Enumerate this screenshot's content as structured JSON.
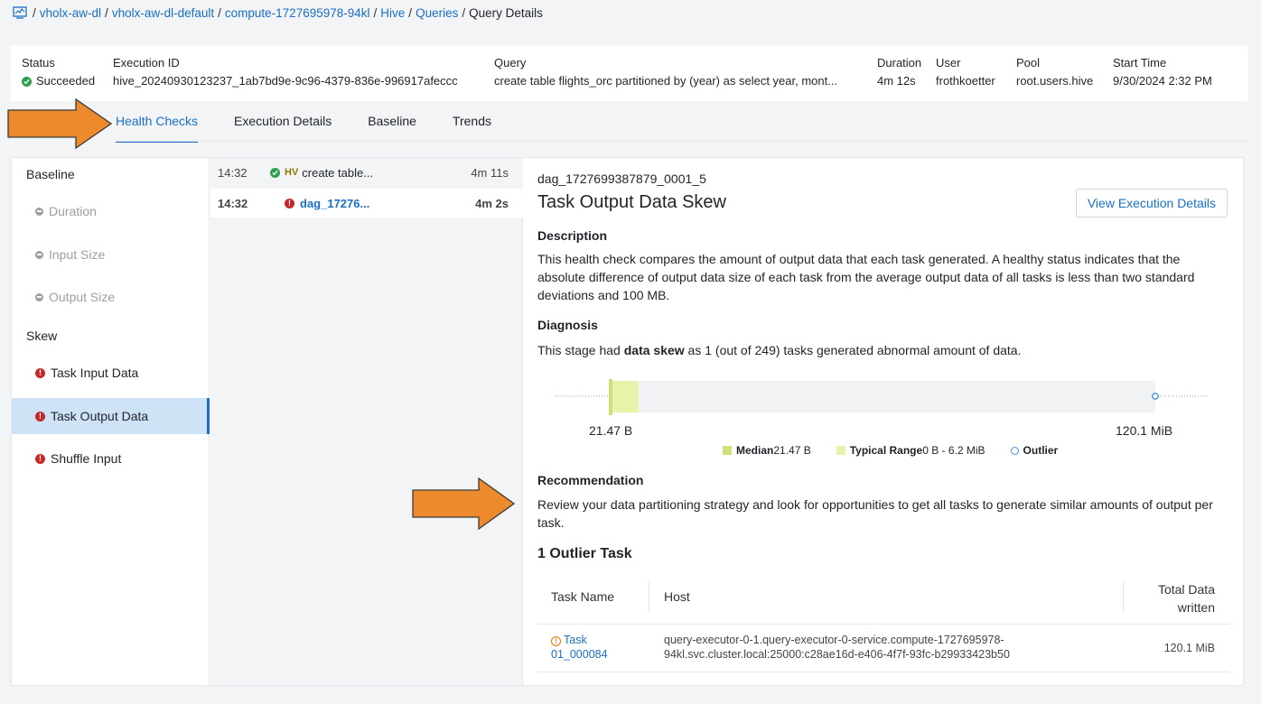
{
  "breadcrumb": {
    "icon": "chart-monitor-icon",
    "items": [
      "vholx-aw-dl",
      "vholx-aw-dl-default",
      "compute-1727695978-94kl",
      "Hive",
      "Queries"
    ],
    "current": "Query Details"
  },
  "summary": {
    "status": {
      "label": "Status",
      "value": "Succeeded"
    },
    "execution_id": {
      "label": "Execution ID",
      "value": "hive_20240930123237_1ab7bd9e-9c96-4379-836e-996917afeccc"
    },
    "query": {
      "label": "Query",
      "value": "create table flights_orc partitioned by (year) as select year, mont..."
    },
    "duration": {
      "label": "Duration",
      "value": "4m 12s"
    },
    "user": {
      "label": "User",
      "value": "frothkoetter"
    },
    "pool": {
      "label": "Pool",
      "value": "root.users.hive"
    },
    "start_time": {
      "label": "Start Time",
      "value": "9/30/2024 2:32 PM"
    }
  },
  "tabs": [
    "Health Checks",
    "Execution Details",
    "Baseline",
    "Trends"
  ],
  "left_nav": {
    "baseline_header": "Baseline",
    "baseline_items": [
      "Duration",
      "Input Size",
      "Output Size"
    ],
    "skew_header": "Skew",
    "skew_items": [
      "Task Input Data",
      "Task Output Data",
      "Shuffle Input"
    ]
  },
  "middle_list": [
    {
      "time": "14:32",
      "badge": "HV",
      "label": "create table...",
      "duration": "4m 11s"
    },
    {
      "time": "14:32",
      "label": "dag_17276...",
      "duration": "4m 2s"
    }
  ],
  "detail": {
    "dag_id": "dag_1727699387879_0001_5",
    "title": "Task Output Data Skew",
    "view_button": "View Execution Details",
    "description_heading": "Description",
    "description": "This health check compares the amount of output data that each task generated. A healthy status indicates that the absolute difference of output data size of each task from the average output data of all tasks is less than two standard deviations and 100 MB.",
    "diagnosis_heading": "Diagnosis",
    "diagnosis_pre": "This stage had ",
    "diagnosis_bold": "data skew",
    "diagnosis_post": " as 1 (out of 249) tasks generated abnormal amount of data.",
    "recommendation_heading": "Recommendation",
    "recommendation": "Review your data partitioning strategy and look for opportunities to get all tasks to generate similar amounts of output per task.",
    "outlier_heading": "1 Outlier Task",
    "table": {
      "headers": [
        "Task Name",
        "Host",
        "Total Data written"
      ],
      "rows": [
        {
          "task_name": "Task 01_000084",
          "host": "query-executor-0-1.query-executor-0-service.compute-1727695978-94kl.svc.cluster.local:25000:c28ae16d-e406-4f7f-93fc-b29933423b50",
          "total": "120.1 MiB"
        }
      ]
    }
  },
  "chart_data": {
    "type": "box",
    "min_label": "21.47 B",
    "max_label": "120.1 MiB",
    "legend": {
      "median_label": "Median",
      "median_value": "21.47 B",
      "range_label": "Typical Range",
      "range_value": "0 B - 6.2 MiB",
      "outlier_label": "Outlier"
    },
    "colors": {
      "median": "#cde07a",
      "range": "#e8f2a8",
      "outlier": "#4a90d9"
    }
  }
}
